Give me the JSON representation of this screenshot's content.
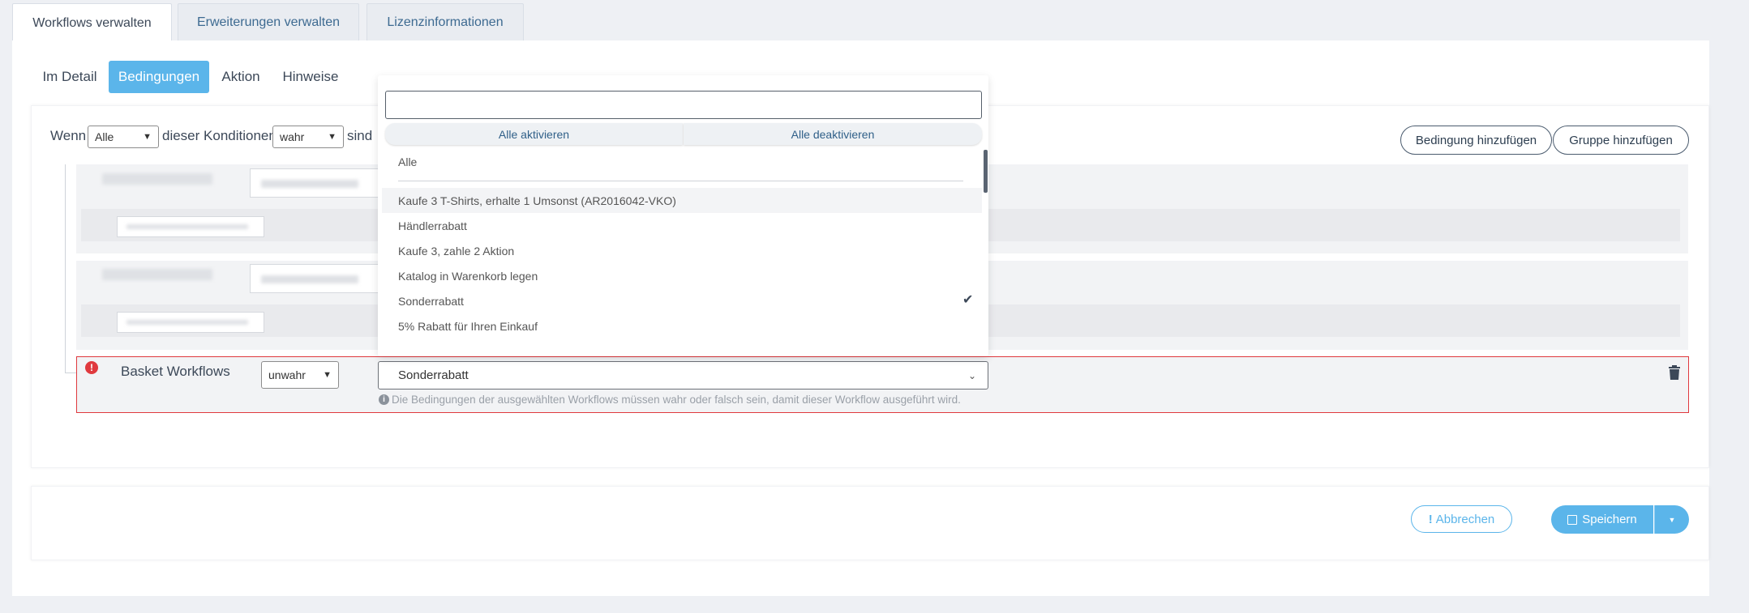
{
  "top_tabs": [
    {
      "label": "Workflows verwalten",
      "active": true
    },
    {
      "label": "Erweiterungen verwalten",
      "active": false
    },
    {
      "label": "Lizenzinformationen",
      "active": false
    }
  ],
  "sub_tabs": [
    {
      "label": "Im Detail",
      "active": false
    },
    {
      "label": "Bedingungen",
      "active": true
    },
    {
      "label": "Aktion",
      "active": false
    },
    {
      "label": "Hinweise",
      "active": false
    }
  ],
  "condition_header": {
    "wenn": "Wenn",
    "match_select": "Alle",
    "dieser": "dieser Konditionen",
    "bool_select": "wahr",
    "sind": "sind"
  },
  "buttons": {
    "add_condition": "Bedingung hinzufügen",
    "add_group": "Gruppe hinzufügen"
  },
  "dropdown": {
    "search_placeholder": "",
    "select_all": "Alle aktivieren",
    "deselect_all": "Alle deaktivieren",
    "group_all": "Alle",
    "options": [
      {
        "label": "Kaufe 3 T-Shirts, erhalte 1 Umsonst (AR2016042-VKO)",
        "selected": false,
        "hover": true
      },
      {
        "label": "Händlerrabatt",
        "selected": false
      },
      {
        "label": "Kaufe 3, zahle 2 Aktion",
        "selected": false
      },
      {
        "label": "Katalog in Warenkorb legen",
        "selected": false
      },
      {
        "label": "Sonderrabatt",
        "selected": true
      },
      {
        "label": "5% Rabatt für Ihren Einkauf",
        "selected": false
      }
    ]
  },
  "basket_condition": {
    "title": "Basket Workflows",
    "bool_select": "unwahr",
    "workflow_select": "Sonderrabatt",
    "hint": "Die Bedingungen der ausgewählten Workflows müssen wahr oder falsch sein, damit dieser Workflow ausgeführt wird."
  },
  "footer": {
    "cancel": "Abbrechen",
    "save": "Speichern"
  },
  "colors": {
    "accent": "#5bb5ea",
    "error": "#e0393e",
    "link": "#3d6a91"
  }
}
